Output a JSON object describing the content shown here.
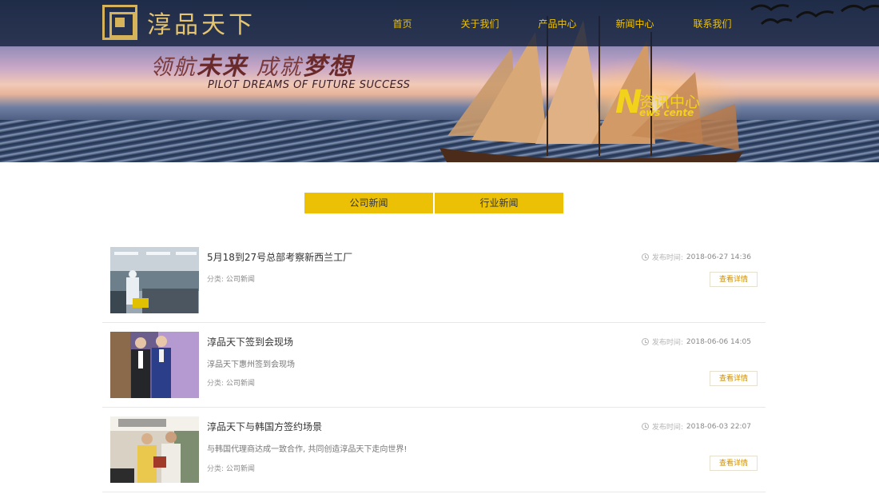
{
  "site": {
    "logo_text": "淳品天下",
    "nav": [
      "首页",
      "关于我们",
      "产品中心",
      "新闻中心",
      "联系我们"
    ]
  },
  "banner": {
    "slogan_cn_1a": "领航",
    "slogan_cn_1b": "未来",
    "slogan_cn_2a": "成就",
    "slogan_cn_2b": "梦想",
    "slogan_en": "PILOT DREAMS OF FUTURE  SUCCESS",
    "section_letter": "N",
    "section_cn": "资讯中心",
    "section_en": "ews cente"
  },
  "tabs": [
    "公司新闻",
    "行业新闻"
  ],
  "labels": {
    "publish_time": "发布时间:",
    "category": "分类:",
    "more": "查看详情"
  },
  "news": [
    {
      "title": "5月18到27号总部考察新西兰工厂",
      "summary": "",
      "category": "公司新闻",
      "date": "2018-06-27 14:36"
    },
    {
      "title": "淳品天下签到会现场",
      "summary": "淳品天下惠州签到会现场",
      "category": "公司新闻",
      "date": "2018-06-06 14:05"
    },
    {
      "title": "淳品天下与韩国方签约场景",
      "summary": "与韩国代理商达成一致合作, 共同创造淳品天下走向世界!",
      "category": "公司新闻",
      "date": "2018-06-03 22:07"
    }
  ]
}
